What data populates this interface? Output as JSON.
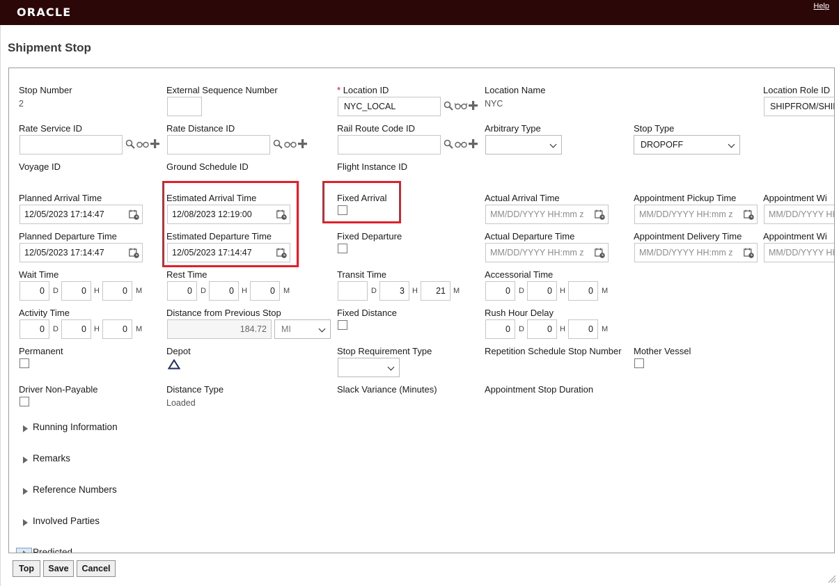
{
  "header": {
    "brand": "ORACLE",
    "help": "Help"
  },
  "page": {
    "title": "Shipment Stop"
  },
  "fields": {
    "stop_number": {
      "label": "Stop Number",
      "value": "2"
    },
    "external_sequence": {
      "label": "External Sequence Number",
      "value": ""
    },
    "location_id": {
      "required": "*",
      "label": "Location ID",
      "value": "NYC_LOCAL"
    },
    "location_name": {
      "label": "Location Name",
      "value": "NYC"
    },
    "location_role": {
      "label": "Location Role ID",
      "value": "SHIPFROM/SHIPTO"
    },
    "rate_service": {
      "label": "Rate Service ID",
      "value": ""
    },
    "rate_distance": {
      "label": "Rate Distance ID",
      "value": ""
    },
    "rail_route": {
      "label": "Rail Route Code ID",
      "value": ""
    },
    "arbitrary_type": {
      "label": "Arbitrary Type",
      "value": ""
    },
    "stop_type": {
      "label": "Stop Type",
      "value": "DROPOFF"
    },
    "voyage_id": {
      "label": "Voyage ID"
    },
    "ground_schedule": {
      "label": "Ground Schedule ID"
    },
    "flight_instance": {
      "label": "Flight Instance ID"
    },
    "planned_arrival": {
      "label": "Planned Arrival Time",
      "value": "12/05/2023 17:14:47"
    },
    "estimated_arrival": {
      "label": "Estimated Arrival Time",
      "value": "12/08/2023 12:19:00"
    },
    "fixed_arrival": {
      "label": "Fixed Arrival",
      "checked": false
    },
    "actual_arrival": {
      "label": "Actual Arrival Time",
      "placeholder": "MM/DD/YYYY HH:mm z"
    },
    "appt_pickup": {
      "label": "Appointment Pickup Time",
      "placeholder": "MM/DD/YYYY HH:mm z"
    },
    "appt_window_1": {
      "label": "Appointment Wi",
      "placeholder": "MM/DD/YYYY HH:"
    },
    "planned_departure": {
      "label": "Planned Departure Time",
      "value": "12/05/2023 17:14:47"
    },
    "estimated_departure": {
      "label": "Estimated Departure Time",
      "value": "12/05/2023 17:14:47"
    },
    "fixed_departure": {
      "label": "Fixed Departure",
      "checked": false
    },
    "actual_departure": {
      "label": "Actual Departure Time",
      "placeholder": "MM/DD/YYYY HH:mm z"
    },
    "appt_delivery": {
      "label": "Appointment Delivery Time",
      "placeholder": "MM/DD/YYYY HH:mm z"
    },
    "appt_window_2": {
      "label": "Appointment Wi",
      "placeholder": "MM/DD/YYYY HH:"
    },
    "wait_time": {
      "label": "Wait Time",
      "d": "0",
      "h": "0",
      "m": "0"
    },
    "rest_time": {
      "label": "Rest Time",
      "d": "0",
      "h": "0",
      "m": "0"
    },
    "transit_time": {
      "label": "Transit Time",
      "d": "",
      "h": "3",
      "m": "21"
    },
    "accessorial_time": {
      "label": "Accessorial Time",
      "d": "0",
      "h": "0",
      "m": "0"
    },
    "activity_time": {
      "label": "Activity Time",
      "d": "0",
      "h": "0",
      "m": "0"
    },
    "distance_prev": {
      "label": "Distance from Previous Stop",
      "value": "184.72",
      "unit": "MI"
    },
    "fixed_distance": {
      "label": "Fixed Distance",
      "checked": false
    },
    "rush_hour": {
      "label": "Rush Hour Delay",
      "d": "0",
      "h": "0",
      "m": "0"
    },
    "permanent": {
      "label": "Permanent",
      "checked": false
    },
    "depot": {
      "label": "Depot"
    },
    "stop_requirement": {
      "label": "Stop Requirement Type",
      "value": ""
    },
    "repetition_schedule": {
      "label": "Repetition Schedule Stop Number"
    },
    "mother_vessel": {
      "label": "Mother Vessel",
      "checked": false
    },
    "driver_non_payable": {
      "label": "Driver Non-Payable",
      "checked": false
    },
    "distance_type": {
      "label": "Distance Type",
      "value": "Loaded"
    },
    "slack_variance": {
      "label": "Slack Variance (Minutes)"
    },
    "appt_stop_duration": {
      "label": "Appointment Stop Duration"
    }
  },
  "units": {
    "d": "D",
    "h": "H",
    "m": "M"
  },
  "sections": [
    "Running Information",
    "Remarks",
    "Reference Numbers",
    "Involved Parties",
    "Predicted"
  ],
  "buttons": {
    "top": "Top",
    "save": "Save",
    "cancel": "Cancel"
  },
  "colors": {
    "header": "#2b0707",
    "highlight": "#e0202a",
    "required": "#c8102e"
  }
}
